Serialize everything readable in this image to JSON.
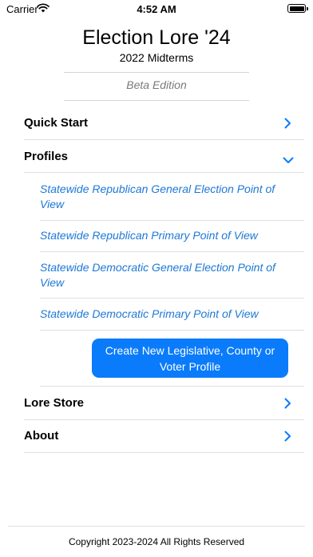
{
  "status_bar": {
    "carrier": "Carrier",
    "time": "4:52 AM"
  },
  "header": {
    "title": "Election Lore '24",
    "subtitle": "2022 Midterms",
    "edition": "Beta Edition"
  },
  "menu": {
    "quick_start": "Quick Start",
    "profiles": "Profiles",
    "lore_store": "Lore Store",
    "about": "About"
  },
  "profiles": [
    {
      "label": "Statewide Republican General Election Point of View"
    },
    {
      "label": "Statewide Republican Primary Point of View"
    },
    {
      "label": "Statewide Democratic General Election Point of View"
    },
    {
      "label": "Statewide Democratic Primary Point of View"
    }
  ],
  "create_button": "Create New Legislative, County or Voter Profile",
  "footer": {
    "copyright": "Copyright 2023-2024 All Rights Reserved"
  },
  "colors": {
    "accent": "#0a7bfb",
    "link": "#1d78d6",
    "muted": "#7a7a7a"
  }
}
